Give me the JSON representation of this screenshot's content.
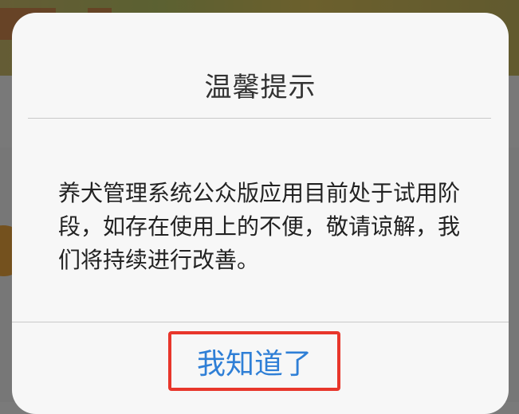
{
  "dialog": {
    "title": "温馨提示",
    "message": "养犬管理系统公众版应用目前处于试用阶段，如存在使用上的不便，敬请谅解，我们将持续进行改善。",
    "confirm_label": "我知道了"
  },
  "colors": {
    "accent": "#2f7fd6",
    "highlight_border": "#e8362b",
    "dialog_background": "#f7f7f7"
  }
}
